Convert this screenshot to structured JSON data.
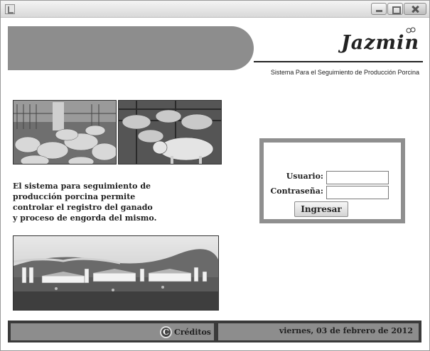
{
  "window": {
    "title": "",
    "buttons": [
      "minimize",
      "maximize",
      "close"
    ]
  },
  "header": {
    "logo_text": "Jazmin",
    "subtitle": "Sistema Para el Seguimiento de Producción Porcina"
  },
  "description": "El sistema para seguimiento de\nproducción porcina permite\ncontrolar el registro del ganado\ny proceso de engorda del mismo.",
  "login": {
    "user_label": "Usuario:",
    "user_value": "",
    "password_label": "Contraseña:",
    "password_value": "",
    "submit_label": "Ingresar"
  },
  "footer": {
    "credits_icon": "copyright-icon",
    "credits_label": "Créditos",
    "date": "viernes,  03 de febrero de 2012"
  },
  "images": [
    "pigs-in-pen-photo",
    "pig-standing-photo",
    "farm-buildings-photo"
  ]
}
